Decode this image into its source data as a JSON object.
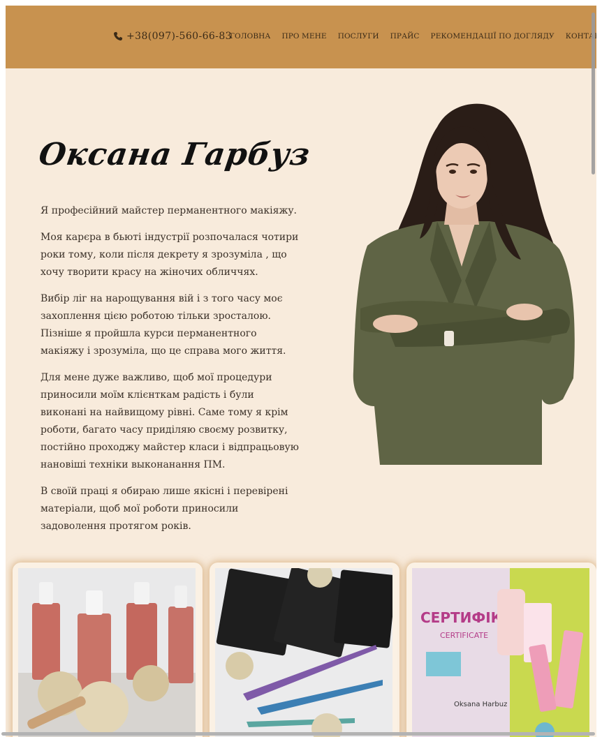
{
  "header": {
    "phone": "+38(097)-560-66-83",
    "nav": [
      "ГОЛОВНА",
      "ПРО МЕНЕ",
      "ПОСЛУГИ",
      "ПРАЙС",
      "РЕКОМЕНДАЦІЇ ПО ДОГЛЯДУ",
      "КОНТАКТИ"
    ]
  },
  "title": "Оксана Гарбуз",
  "bio": [
    "Я професійний майстер перманентного макіяжу.",
    "Моя карєра в бьюті індустрії розпочалася чотири роки тому, коли після декрету я зрозуміла , що хочу творити красу на жіночих обличчях.",
    "Вибір ліг на нарощування вій і з того часу моє захоплення цією роботою тільки зросталою. Пізніше я пройшла курси перманентного макіяжу і зрозуміла, що це справа мого життя.",
    "Для мене дуже важливо, щоб мої процедури приносили моїм клієнткам радість і були виконані на найвищому рівні. Саме тому я крім роботи, багато часу приділяю своєму розвитку, постійно проходжу майстер класи і відпрацьовую нановіші техніки выконанання ПМ.",
    "В своїй праці я обираю лише якісні і перевірені матеріали, щоб мої роботи приносили задоволення протягом років."
  ],
  "gallery": {
    "certificate_heading": "СЕРТИФІКАТ",
    "certificate_sub": "CERTIFICATE",
    "certificate_name": "Oksana Harbuz"
  },
  "colors": {
    "header_bg": "#c8924f",
    "page_bg": "#f8ebdc",
    "text": "#3a3028"
  }
}
